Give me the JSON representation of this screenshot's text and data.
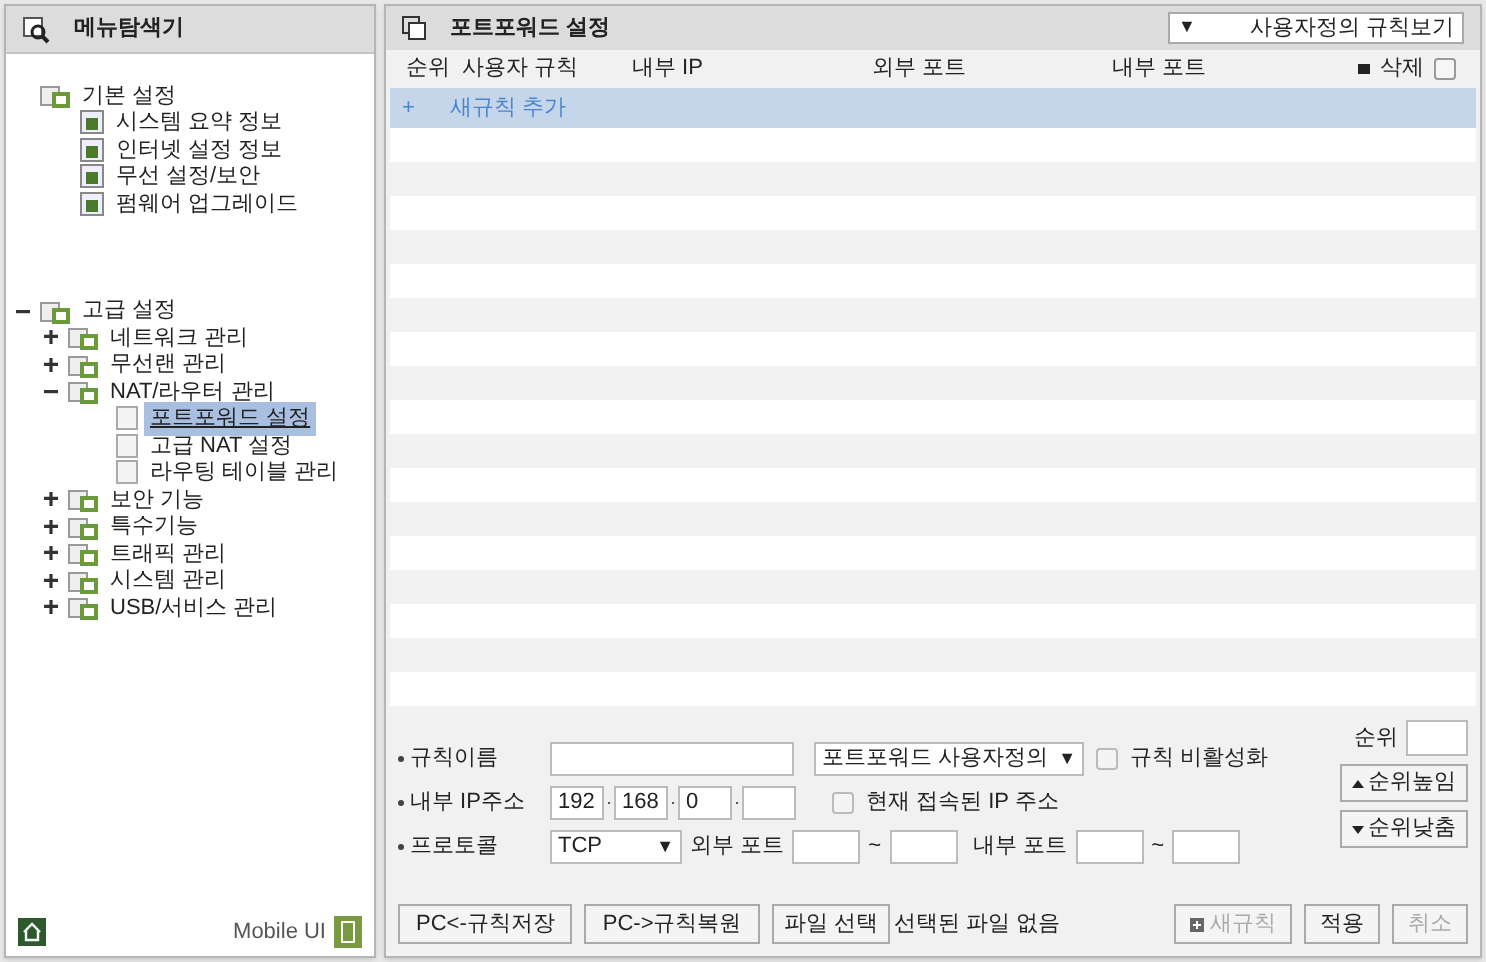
{
  "sidebar": {
    "title": "메뉴탐색기",
    "tree": [
      {
        "label": "기본 설정",
        "kind": "static",
        "selected": false,
        "children": [
          {
            "label": "시스템 요약 정보",
            "kind": "page",
            "selected": false
          },
          {
            "label": "인터넷 설정 정보",
            "kind": "page",
            "selected": false
          },
          {
            "label": "무선 설정/보안",
            "kind": "page",
            "selected": false
          },
          {
            "label": "펌웨어 업그레이드",
            "kind": "page",
            "selected": false
          }
        ]
      },
      {
        "label": "고급 설정",
        "kind": "group",
        "expanded": true,
        "selected": false,
        "children": [
          {
            "label": "네트워크 관리",
            "kind": "group",
            "expanded": false,
            "selected": false
          },
          {
            "label": "무선랜 관리",
            "kind": "group",
            "expanded": false,
            "selected": false
          },
          {
            "label": "NAT/라우터 관리",
            "kind": "group",
            "expanded": true,
            "selected": false,
            "children": [
              {
                "label": "포트포워드 설정",
                "kind": "leaf",
                "selected": true
              },
              {
                "label": "고급 NAT 설정",
                "kind": "leaf",
                "selected": false
              },
              {
                "label": "라우팅 테이블 관리",
                "kind": "leaf",
                "selected": false
              }
            ]
          },
          {
            "label": "보안 기능",
            "kind": "group",
            "expanded": false,
            "selected": false
          },
          {
            "label": "특수기능",
            "kind": "group",
            "expanded": false,
            "selected": false
          },
          {
            "label": "트래픽 관리",
            "kind": "group",
            "expanded": false,
            "selected": false
          },
          {
            "label": "시스템 관리",
            "kind": "group",
            "expanded": false,
            "selected": false
          },
          {
            "label": "USB/서비스 관리",
            "kind": "group",
            "expanded": false,
            "selected": false
          }
        ]
      }
    ],
    "mobile_label": "Mobile UI"
  },
  "panel": {
    "title": "포트포워드 설정",
    "view_select": {
      "arrow": "▼",
      "value": "사용자정의 규칙보기"
    }
  },
  "table": {
    "columns": [
      "순위",
      "사용자 규칙",
      "내부 IP",
      "외부 포트",
      "내부 포트",
      "삭제"
    ],
    "select_all_checked": false,
    "add_row": {
      "icon": "+",
      "label": "새규칙 추가"
    }
  },
  "form": {
    "rule_name": {
      "label": "규칙이름",
      "type_select": "포트포워드 사용자정의",
      "disable_label": "규칙 비활성화",
      "disable_checked": false
    },
    "internal_ip": {
      "label": "내부 IP주소",
      "octets": [
        "192",
        "168",
        "0"
      ],
      "current_label": "현재 접속된 IP 주소",
      "current_checked": false
    },
    "protocol": {
      "label": "프로토콜",
      "value": "TCP",
      "ext_label": "외부 포트",
      "int_label": "내부 포트",
      "tilde": "~"
    },
    "rank": {
      "label": "순위",
      "up": "순위높임",
      "down": "순위낮춤"
    }
  },
  "buttons": [
    {
      "label": "PC<-규칙저장",
      "disabled": false
    },
    {
      "label": "PC->규칙복원",
      "disabled": false
    },
    {
      "label": "파일 선택",
      "disabled": false
    }
  ],
  "file_status": "선택된 파일 없음",
  "actions": [
    {
      "label": "새규칙",
      "kind": "new",
      "disabled": true
    },
    {
      "label": "적용",
      "kind": "plain",
      "disabled": false
    },
    {
      "label": "취소",
      "kind": "plain",
      "disabled": true
    }
  ]
}
